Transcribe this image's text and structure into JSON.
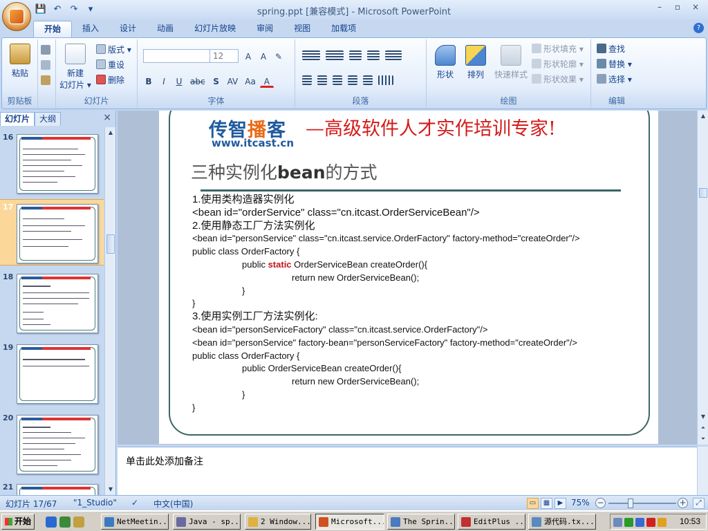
{
  "window": {
    "title": "spring.ppt [兼容模式] - Microsoft PowerPoint",
    "controls": [
      "–",
      "▫",
      "×"
    ]
  },
  "qat": {
    "save": "💾",
    "undo": "↶",
    "redo": "↷",
    "more": "▾"
  },
  "tabs": [
    "开始",
    "插入",
    "设计",
    "动画",
    "幻灯片放映",
    "审阅",
    "视图",
    "加载项"
  ],
  "help": "?",
  "ribbon": {
    "clipboard": {
      "label": "剪贴板",
      "paste": "粘贴"
    },
    "slides": {
      "label": "幻灯片",
      "new_slide": "新建",
      "new_slide2": "幻灯片 ▾",
      "layout": "版式 ▾",
      "reset": "重设",
      "delete": "删除"
    },
    "font": {
      "label": "字体",
      "font_name": "",
      "font_size": "12",
      "grow": "A",
      "shrink": "A",
      "clear": "✎",
      "bold": "B",
      "italic": "I",
      "underline": "U",
      "strike": "abc",
      "shadow": "S",
      "spacing": "AV",
      "case": "Aa",
      "color": "A"
    },
    "paragraph": {
      "label": "段落"
    },
    "drawing": {
      "label": "绘图",
      "shapes": "形状",
      "arrange": "排列",
      "quick_styles": "快速样式",
      "fill": "形状填充 ▾",
      "outline": "形状轮廓 ▾",
      "effects": "形状效果 ▾"
    },
    "editing": {
      "label": "编辑",
      "find": "查找",
      "replace": "替换 ▾",
      "select": "选择 ▾"
    }
  },
  "panel": {
    "tab_slides": "幻灯片",
    "tab_outline": "大纲",
    "close": "×"
  },
  "thumbnails": [
    {
      "num": "16"
    },
    {
      "num": "17"
    },
    {
      "num": "18"
    },
    {
      "num": "19"
    },
    {
      "num": "20"
    },
    {
      "num": "21"
    }
  ],
  "slide": {
    "logo_a": "传智",
    "logo_b": "播",
    "logo_c": "客",
    "logo_url": "www.itcast.cn",
    "slogan": "—高级软件人才实作培训专家!",
    "title_a": "三种实例化",
    "title_b": "bean",
    "title_c": "的方式",
    "lines": [
      "1.使用类构造器实例化",
      "<bean id=\"orderService\" class=\"cn.itcast.OrderServiceBean\"/>",
      "2.使用静态工厂方法实例化",
      "<bean id=\"personService\" class=\"cn.itcast.service.OrderFactory\" factory-method=\"createOrder\"/>",
      "public class OrderFactory {",
      "public ",
      "static",
      " OrderServiceBean createOrder(){",
      "return new OrderServiceBean();",
      "}",
      "}",
      "3.使用实例工厂方法实例化:",
      "<bean id=\"personServiceFactory\" class=\"cn.itcast.service.OrderFactory\"/>",
      "<bean id=\"personService\" factory-bean=\"personServiceFactory\" factory-method=\"createOrder\"/>",
      "public class OrderFactory {",
      "public OrderServiceBean createOrder(){",
      "return new OrderServiceBean();",
      "}",
      "}"
    ]
  },
  "notes": {
    "placeholder": "单击此处添加备注"
  },
  "status": {
    "slide": "幻灯片 17/67",
    "theme": "\"1_Studio\"",
    "lang": "中文(中国)",
    "zoom": "75%"
  },
  "taskbar": {
    "start": "开始",
    "tasks": [
      "NetMeetin...",
      "Java - sp...",
      "2 Window...",
      "Microsoft...",
      "The Sprin...",
      "EditPlus ...",
      "源代码.tx..."
    ],
    "clock": "10:53"
  }
}
